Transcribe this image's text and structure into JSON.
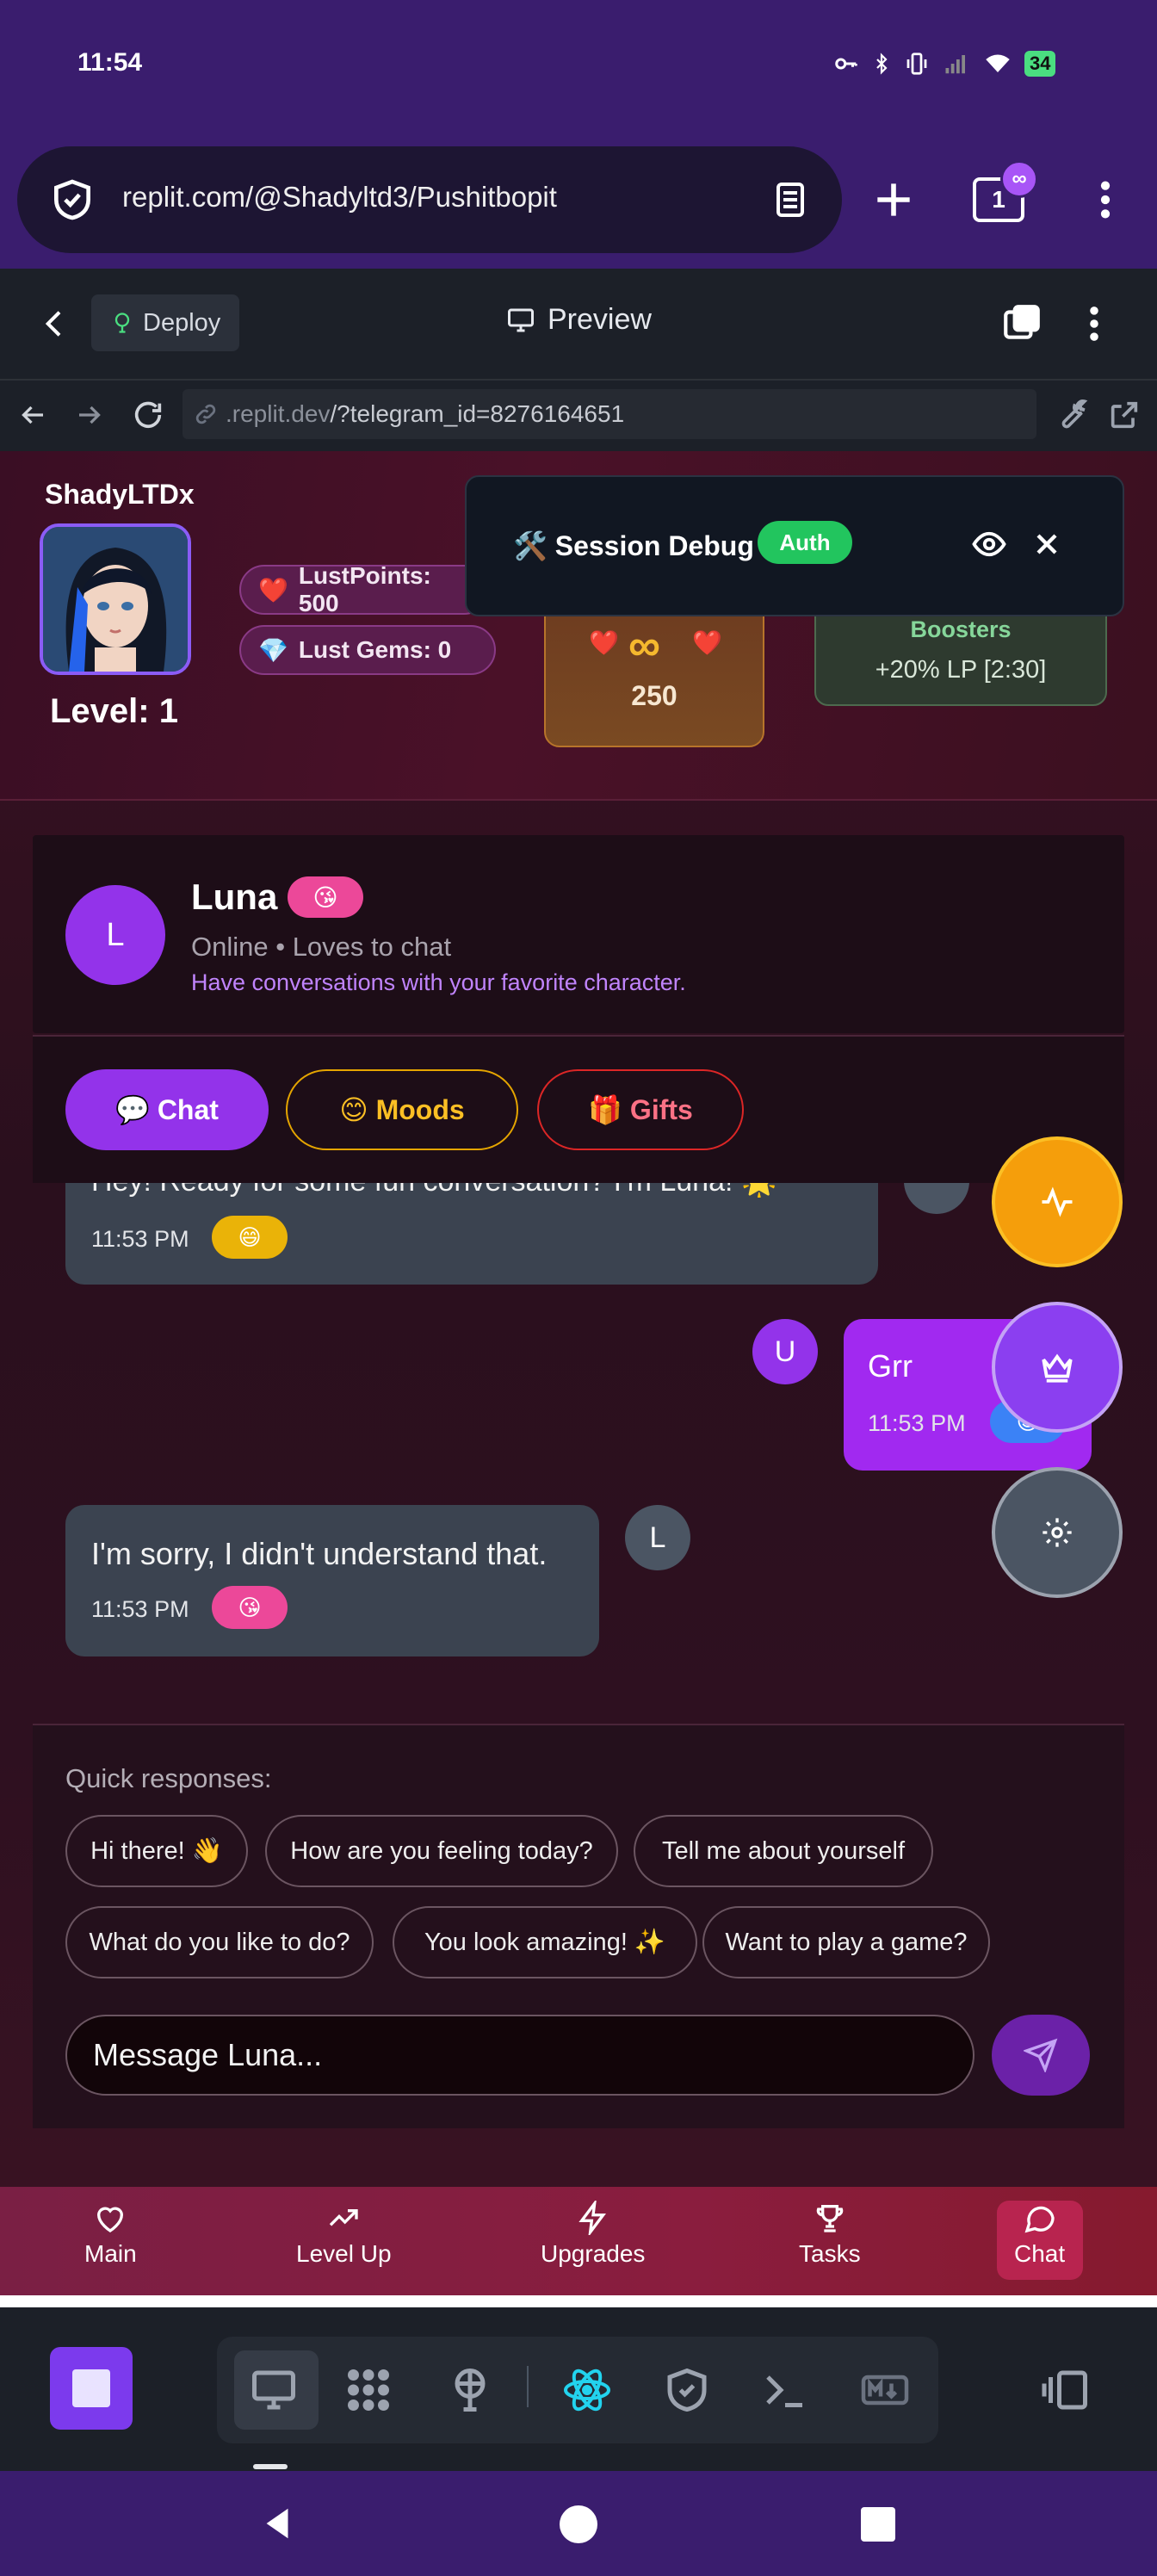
{
  "status_bar": {
    "time": "11:54",
    "battery": "34"
  },
  "browser": {
    "url": "replit.com/@Shadyltd3/Pushitbopit",
    "tab_count": "1"
  },
  "replit": {
    "deploy_label": "Deploy",
    "preview_label": "Preview",
    "address_prefix": ".replit.dev",
    "address_path": "/?telegram_id=8276164651"
  },
  "profile": {
    "username": "ShadyLTDx",
    "level": "Level: 1",
    "lust_points": "LustPoints: 500",
    "lust_gems": "Lust Gems: 0"
  },
  "streak": {
    "symbol": "∞",
    "value": "250"
  },
  "boosters": {
    "title": "Boosters",
    "value": "+20% LP [2:30]"
  },
  "debug": {
    "title": "🛠️ Session Debug",
    "badge": "Auth"
  },
  "character": {
    "initial": "L",
    "name": "Luna",
    "emoji": "😘",
    "status": "Online • Loves to chat",
    "description": "Have conversations with your favorite character."
  },
  "tabs": [
    {
      "label": "💬 Chat"
    },
    {
      "label": "😊 Moods"
    },
    {
      "label": "🎁 Gifts"
    }
  ],
  "messages": [
    {
      "text": "Hey! Ready for some fun conversation? I'm Luna! 🌟",
      "time": "11:53 PM",
      "emoji": "😄"
    },
    {
      "text": "Grr",
      "time": "11:53 PM",
      "emoji": "😊",
      "avatar": "U"
    },
    {
      "text": "I'm sorry, I didn't understand that.",
      "time": "11:53 PM",
      "emoji": "😘",
      "avatar": "L"
    }
  ],
  "quick_responses": {
    "label": "Quick responses:",
    "items": [
      "Hi there! 👋",
      "How are you feeling today?",
      "Tell me about yourself",
      "What do you like to do?",
      "You look amazing! ✨",
      "Want to play a game?"
    ]
  },
  "composer": {
    "placeholder": "Message Luna..."
  },
  "bottom_nav": [
    {
      "label": "Main",
      "icon": "heart-icon"
    },
    {
      "label": "Level Up",
      "icon": "trending-up-icon"
    },
    {
      "label": "Upgrades",
      "icon": "bolt-icon"
    },
    {
      "label": "Tasks",
      "icon": "trophy-icon"
    },
    {
      "label": "Chat",
      "icon": "chat-icon"
    }
  ],
  "colors": {
    "accent_purple": "#9333ea",
    "status_bar": "#3a1d6e",
    "nav_gradient_start": "#7a1f44",
    "auth_green": "#22c55e"
  }
}
